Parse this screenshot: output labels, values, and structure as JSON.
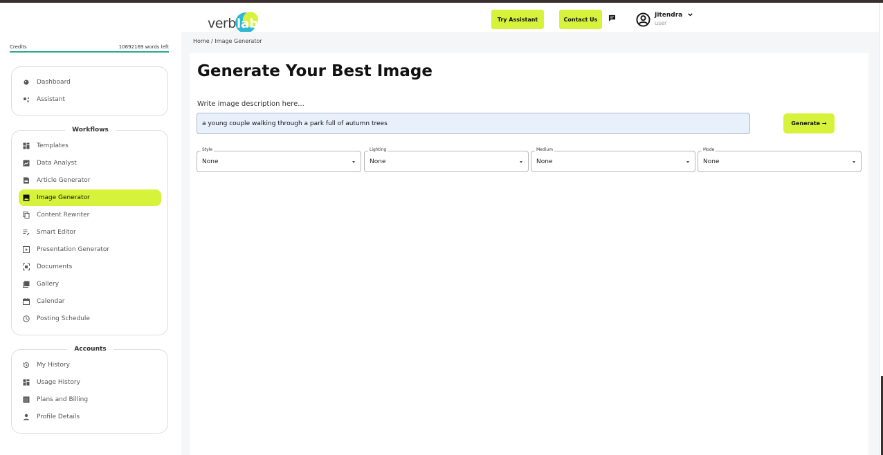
{
  "header": {
    "logo": {
      "word": "verbi",
      "lab": "lab"
    },
    "try_assistant": "Try Assistant",
    "contact_us": "Contact Us",
    "user": {
      "name": "Jitendra",
      "role": "user"
    }
  },
  "sidebar": {
    "credits": {
      "label": "Credits",
      "value": "10692169 words left"
    },
    "top_items": [
      {
        "label": "Dashboard",
        "icon": "palette-icon"
      },
      {
        "label": "Assistant",
        "icon": "assistant-icon"
      }
    ],
    "workflows": {
      "title": "Workflows",
      "items": [
        {
          "label": "Templates",
          "icon": "templates-icon"
        },
        {
          "label": "Data Analyst",
          "icon": "data-analyst-icon"
        },
        {
          "label": "Article Generator",
          "icon": "article-icon"
        },
        {
          "label": "Image Generator",
          "icon": "image-icon",
          "active": true
        },
        {
          "label": "Content Rewriter",
          "icon": "copy-icon"
        },
        {
          "label": "Smart Editor",
          "icon": "edit-lines-icon"
        },
        {
          "label": "Presentation Generator",
          "icon": "play-box-icon"
        },
        {
          "label": "Documents",
          "icon": "documents-icon"
        },
        {
          "label": "Gallery",
          "icon": "gallery-icon"
        },
        {
          "label": "Calendar",
          "icon": "calendar-icon"
        },
        {
          "label": "Posting Schedule",
          "icon": "clock-icon"
        }
      ]
    },
    "accounts": {
      "title": "Accounts",
      "items": [
        {
          "label": "My History",
          "icon": "history-icon"
        },
        {
          "label": "Usage History",
          "icon": "usage-icon"
        },
        {
          "label": "Plans and Billing",
          "icon": "billing-icon"
        },
        {
          "label": "Profile Details",
          "icon": "person-icon"
        }
      ]
    }
  },
  "breadcrumb": {
    "home": "Home",
    "separator": "/",
    "current": "Image Generator"
  },
  "main": {
    "title": "Generate Your Best Image",
    "description_label": "Write image description here...",
    "prompt_value": "a young couple walking through a park full of autumn trees",
    "generate_label": "Generate →",
    "selects": [
      {
        "label": "Style",
        "value": "None"
      },
      {
        "label": "Lighting",
        "value": "None"
      },
      {
        "label": "Medium",
        "value": "None"
      },
      {
        "label": "Mode",
        "value": "None"
      }
    ]
  },
  "colors": {
    "accent": "#d6f23a",
    "credits_bar": "#2aa98b",
    "prompt_bg": "#e8f0fc"
  }
}
